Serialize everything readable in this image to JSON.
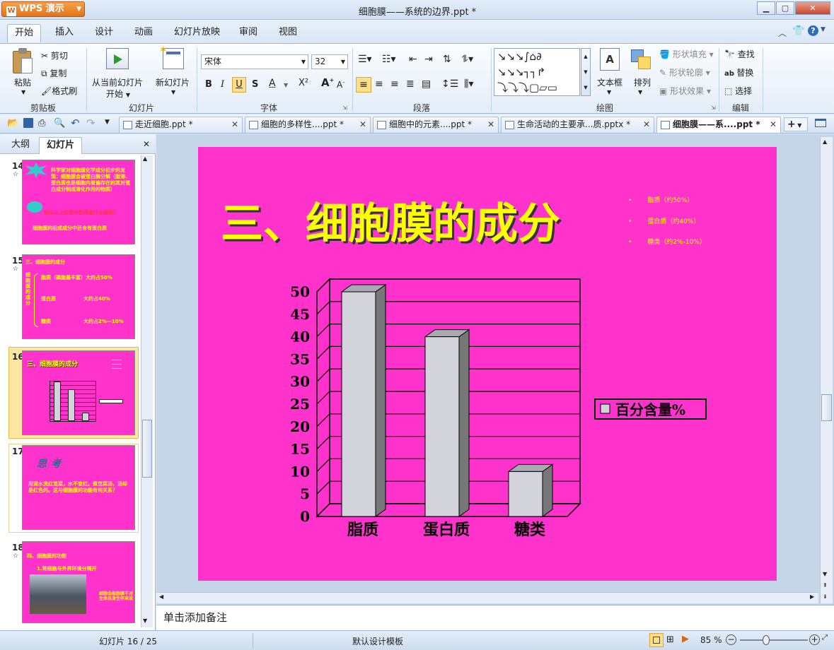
{
  "app": {
    "name": "WPS 演示",
    "title": "细胞膜——系统的边界.ppt *"
  },
  "menu": [
    "开始",
    "插入",
    "设计",
    "动画",
    "幻灯片放映",
    "审阅",
    "视图"
  ],
  "ribbon": {
    "clipboard": {
      "paste": "粘贴",
      "cut": "剪切",
      "copy": "复制",
      "format_painter": "格式刷",
      "label": "剪贴板"
    },
    "slides": {
      "from_current": "从当前幻灯片",
      "start": "开始",
      "new_slide": "新幻灯片",
      "label": "幻灯片"
    },
    "font": {
      "name": "宋体",
      "size": "32",
      "label": "字体"
    },
    "paragraph": {
      "label": "段落"
    },
    "drawing": {
      "textbox": "文本框",
      "arrange": "排列",
      "shape_fill": "形状填充",
      "shape_outline": "形状轮廓",
      "shape_effect": "形状效果",
      "label": "绘图"
    },
    "edit": {
      "find": "查找",
      "replace": "替换",
      "select": "选择",
      "label": "编辑"
    }
  },
  "doc_tabs": [
    "走近细胞.ppt *",
    "细胞的多样性....ppt *",
    "细胞中的元素....ppt *",
    "生命活动的主要承...质.pptx *",
    "细胞膜——系....ppt *"
  ],
  "left_panel": {
    "tabs": [
      "大纲",
      "幻灯片"
    ]
  },
  "thumbnails": [
    {
      "num": "14",
      "lines": [
        "科学家对细胞膜化学成分初步的发现：细胞膜会被蛋白酶分解（脂溶、蛋白质也是细胞内普遍存在的其对蛋白成分制成溶化作用的物质）",
        "你从以上实验中能得出什么结论？",
        "细胞膜的组成成分中还含有蛋白质"
      ]
    },
    {
      "num": "15",
      "lines": [
        "三、细胞膜的成分",
        "脂质（磷脂最丰富）大约占50%",
        "蛋白质",
        "大约占40%",
        "糖类",
        "大约占2%—10%",
        "细胞膜的成分"
      ]
    },
    {
      "num": "16",
      "lines": [
        "三、细胞膜的成分"
      ]
    },
    {
      "num": "17",
      "lines": [
        "思考",
        "用清水洗红苋菜，水不变红。煮苋菜汤，汤却是红色的。这与细胞膜的功能有何关系？"
      ]
    },
    {
      "num": "18",
      "lines": [
        "四、细胞膜的功能",
        "1.将细胞与外界环境分隔开",
        "细胞会能胞膜不对生命自身生存来说"
      ]
    }
  ],
  "slide": {
    "title": "三、细胞膜的成分",
    "bullets": [
      {
        "mark": "•",
        "text": "脂质（约50%）"
      },
      {
        "mark": "•",
        "text": "蛋白质（约40%）"
      },
      {
        "mark": "•",
        "text": "糖类（约2%-10%）"
      }
    ]
  },
  "chart_data": {
    "type": "bar",
    "categories": [
      "脂质",
      "蛋白质",
      "糖类"
    ],
    "series": [
      {
        "name": "百分含量%",
        "values": [
          50,
          40,
          10
        ]
      }
    ],
    "ylim": [
      0,
      50
    ],
    "yticks": [
      "0",
      "5",
      "10",
      "15",
      "20",
      "25",
      "30",
      "35",
      "40",
      "45",
      "50"
    ],
    "legend": "right",
    "grid": true,
    "style": "3d",
    "colors": {
      "bar": "#d3d3dc",
      "bar_side": "#777777",
      "plot_bg": "#ff33cc"
    }
  },
  "notes": "单击添加备注",
  "status": {
    "slide_info": "幻灯片 16 / 25",
    "template": "默认设计模板",
    "zoom": "85 %"
  },
  "colors": {
    "slide_bg": "#ff33cc",
    "title": "#ffff00"
  }
}
